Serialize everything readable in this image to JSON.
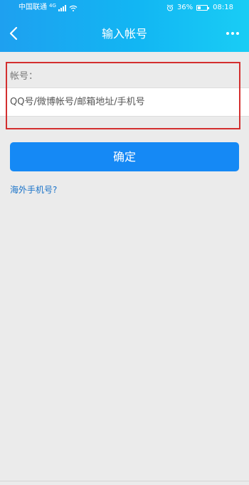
{
  "status_bar": {
    "carrier": "中国联通",
    "network": "4G",
    "battery_percent": "36%",
    "battery_level": 0.36,
    "time": "08:18"
  },
  "header": {
    "title": "输入帐号",
    "back_icon": "chevron-left-icon",
    "more_icon": "more-dots-icon"
  },
  "form": {
    "account_label": "帐号：",
    "account_placeholder": "QQ号/微博帐号/邮箱地址/手机号",
    "account_value": ""
  },
  "actions": {
    "confirm_label": "确定",
    "overseas_link": "海外手机号?"
  },
  "colors": {
    "header_gradient_start": "#1ea0f0",
    "header_gradient_end": "#19cdf5",
    "confirm_button": "#1589f5",
    "link": "#1a73c9",
    "highlight_box": "#d32f2f",
    "background": "#ebebeb"
  }
}
